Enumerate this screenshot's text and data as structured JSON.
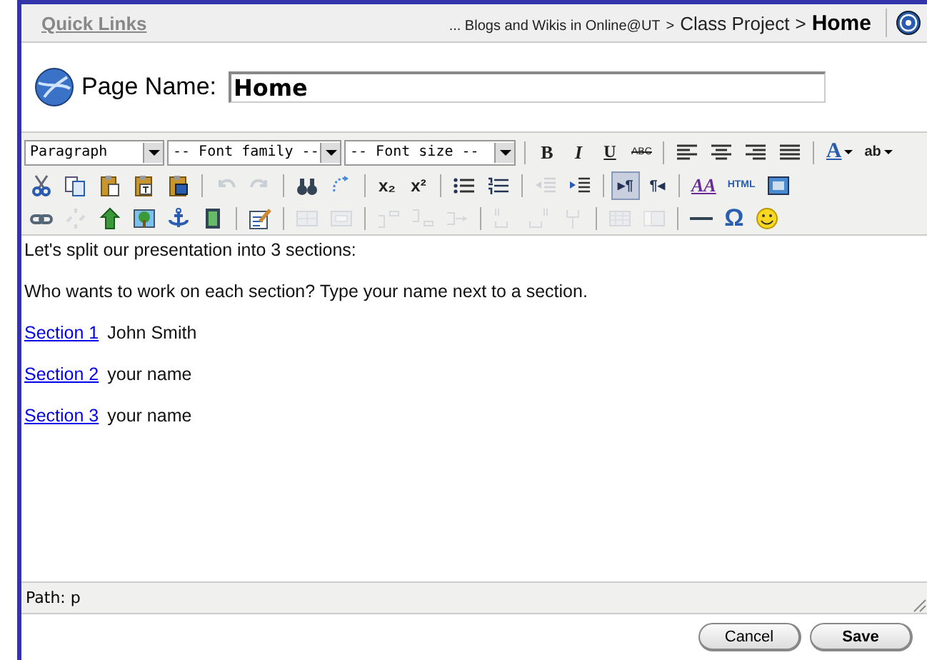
{
  "top_bar": {
    "quick_links": "Quick Links",
    "breadcrumb": [
      {
        "text": "... Blogs and Wikis in Online@UT"
      },
      {
        "text": "Class Project"
      },
      {
        "text": "Home"
      }
    ],
    "separator": ">"
  },
  "page_name": {
    "label": "Page Name:",
    "value": "Home"
  },
  "toolbar": {
    "rows": [
      {
        "buttons": [
          {
            "kind": "select",
            "label": "Paragraph"
          },
          {
            "kind": "select",
            "label": "-- Font family --"
          },
          {
            "kind": "select",
            "label": "-- Font size --"
          },
          {
            "kind": "sep"
          },
          {
            "kind": "bold",
            "text": "B",
            "disabled": false,
            "active": false
          },
          {
            "kind": "italic",
            "text": "I",
            "disabled": false,
            "active": false
          },
          {
            "kind": "underline",
            "text": "U",
            "disabled": false,
            "active": false
          },
          {
            "kind": "strike",
            "text": "ABC",
            "disabled": false,
            "active": false
          },
          {
            "kind": "sep"
          },
          {
            "kind": "alignleft",
            "disabled": false,
            "active": false
          },
          {
            "kind": "aligncenter",
            "disabled": false,
            "active": false
          },
          {
            "kind": "alignright",
            "disabled": false,
            "active": false
          },
          {
            "kind": "justify",
            "disabled": false,
            "active": false
          },
          {
            "kind": "sep"
          },
          {
            "kind": "forecolor",
            "text": "A",
            "disabled": false,
            "active": false
          },
          {
            "kind": "backcolor",
            "text": "ab",
            "disabled": false,
            "active": false
          }
        ]
      },
      {
        "buttons": [
          {
            "kind": "cut",
            "disabled": false,
            "active": false
          },
          {
            "kind": "copy",
            "disabled": false,
            "active": false
          },
          {
            "kind": "paste",
            "disabled": false,
            "active": false
          },
          {
            "kind": "pastetext",
            "disabled": false,
            "active": false
          },
          {
            "kind": "pasteword",
            "disabled": false,
            "active": false
          },
          {
            "kind": "sep"
          },
          {
            "kind": "undo",
            "disabled": true,
            "active": false
          },
          {
            "kind": "redo",
            "disabled": true,
            "active": false
          },
          {
            "kind": "sep"
          },
          {
            "kind": "find",
            "disabled": false,
            "active": false
          },
          {
            "kind": "replace",
            "disabled": false,
            "active": false
          },
          {
            "kind": "sep"
          },
          {
            "kind": "sub",
            "text": "x₂",
            "disabled": false,
            "active": false
          },
          {
            "kind": "sup",
            "text": "x²",
            "disabled": false,
            "active": false
          },
          {
            "kind": "sep"
          },
          {
            "kind": "bullist",
            "disabled": false,
            "active": false
          },
          {
            "kind": "numlist",
            "disabled": false,
            "active": false
          },
          {
            "kind": "sep"
          },
          {
            "kind": "outdent",
            "disabled": true,
            "active": false
          },
          {
            "kind": "indent",
            "disabled": false,
            "active": false
          },
          {
            "kind": "sep"
          },
          {
            "kind": "ltr",
            "text": "▸¶",
            "disabled": false,
            "active": true
          },
          {
            "kind": "rtl",
            "text": "¶◂",
            "disabled": false,
            "active": false
          },
          {
            "kind": "sep"
          },
          {
            "kind": "styles",
            "text": "AA",
            "disabled": false,
            "active": false
          },
          {
            "kind": "html",
            "text": "HTML",
            "disabled": false,
            "active": false
          },
          {
            "kind": "panel",
            "disabled": false,
            "active": false
          }
        ]
      },
      {
        "buttons": [
          {
            "kind": "link",
            "disabled": false,
            "active": false
          },
          {
            "kind": "unlink",
            "disabled": true,
            "active": false
          },
          {
            "kind": "insertfile",
            "disabled": false,
            "active": false
          },
          {
            "kind": "image",
            "disabled": false,
            "active": false
          },
          {
            "kind": "anchor",
            "disabled": false,
            "active": false
          },
          {
            "kind": "media",
            "disabled": false,
            "active": false
          },
          {
            "kind": "sep"
          },
          {
            "kind": "form",
            "disabled": false,
            "active": false
          },
          {
            "kind": "sep"
          },
          {
            "kind": "rowprops",
            "disabled": true,
            "active": false
          },
          {
            "kind": "cellprops",
            "disabled": true,
            "active": false
          },
          {
            "kind": "sep"
          },
          {
            "kind": "rowbefore",
            "disabled": true,
            "active": false
          },
          {
            "kind": "rowafter",
            "disabled": true,
            "active": false
          },
          {
            "kind": "rowdelete",
            "disabled": true,
            "active": false
          },
          {
            "kind": "sep"
          },
          {
            "kind": "colbefore",
            "disabled": true,
            "active": false
          },
          {
            "kind": "colafter",
            "disabled": true,
            "active": false
          },
          {
            "kind": "coldelete",
            "disabled": true,
            "active": false
          },
          {
            "kind": "sep"
          },
          {
            "kind": "split",
            "disabled": true,
            "active": false
          },
          {
            "kind": "merge",
            "disabled": true,
            "active": false
          },
          {
            "kind": "sep"
          },
          {
            "kind": "hr",
            "disabled": false,
            "active": false
          },
          {
            "kind": "charmap",
            "text": "Ω",
            "disabled": false,
            "active": false
          },
          {
            "kind": "smiley",
            "disabled": false,
            "active": false
          }
        ]
      }
    ]
  },
  "content": {
    "paragraphs": [
      "Let's split our presentation into 3 sections:",
      "Who wants to work on each section? Type your name next to a section."
    ],
    "sections": [
      {
        "link": "Section 1",
        "name": "John Smith"
      },
      {
        "link": "Section 2",
        "name": "your name"
      },
      {
        "link": "Section 3",
        "name": "your name"
      }
    ]
  },
  "status_bar": {
    "path": "Path: p"
  },
  "buttons": [
    {
      "label": "Cancel"
    },
    {
      "label": "Save"
    }
  ]
}
